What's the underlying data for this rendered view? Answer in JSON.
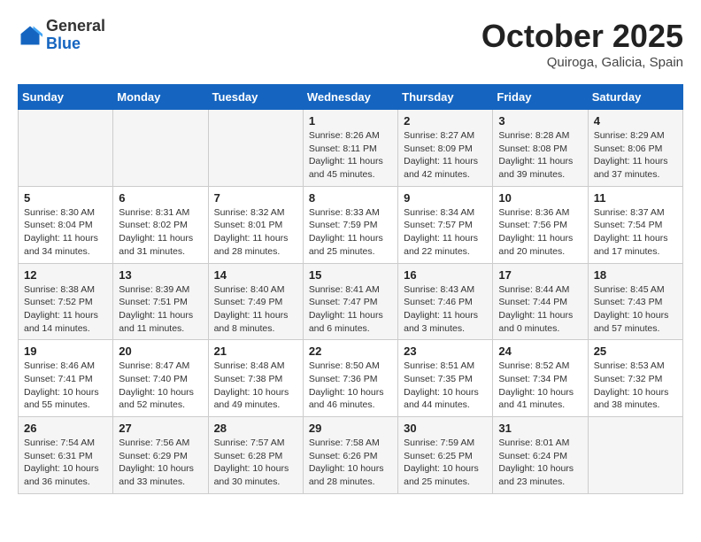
{
  "header": {
    "logo_general": "General",
    "logo_blue": "Blue",
    "month": "October 2025",
    "location": "Quiroga, Galicia, Spain"
  },
  "days_of_week": [
    "Sunday",
    "Monday",
    "Tuesday",
    "Wednesday",
    "Thursday",
    "Friday",
    "Saturday"
  ],
  "weeks": [
    [
      {
        "day": "",
        "info": ""
      },
      {
        "day": "",
        "info": ""
      },
      {
        "day": "",
        "info": ""
      },
      {
        "day": "1",
        "info": "Sunrise: 8:26 AM\nSunset: 8:11 PM\nDaylight: 11 hours and 45 minutes."
      },
      {
        "day": "2",
        "info": "Sunrise: 8:27 AM\nSunset: 8:09 PM\nDaylight: 11 hours and 42 minutes."
      },
      {
        "day": "3",
        "info": "Sunrise: 8:28 AM\nSunset: 8:08 PM\nDaylight: 11 hours and 39 minutes."
      },
      {
        "day": "4",
        "info": "Sunrise: 8:29 AM\nSunset: 8:06 PM\nDaylight: 11 hours and 37 minutes."
      }
    ],
    [
      {
        "day": "5",
        "info": "Sunrise: 8:30 AM\nSunset: 8:04 PM\nDaylight: 11 hours and 34 minutes."
      },
      {
        "day": "6",
        "info": "Sunrise: 8:31 AM\nSunset: 8:02 PM\nDaylight: 11 hours and 31 minutes."
      },
      {
        "day": "7",
        "info": "Sunrise: 8:32 AM\nSunset: 8:01 PM\nDaylight: 11 hours and 28 minutes."
      },
      {
        "day": "8",
        "info": "Sunrise: 8:33 AM\nSunset: 7:59 PM\nDaylight: 11 hours and 25 minutes."
      },
      {
        "day": "9",
        "info": "Sunrise: 8:34 AM\nSunset: 7:57 PM\nDaylight: 11 hours and 22 minutes."
      },
      {
        "day": "10",
        "info": "Sunrise: 8:36 AM\nSunset: 7:56 PM\nDaylight: 11 hours and 20 minutes."
      },
      {
        "day": "11",
        "info": "Sunrise: 8:37 AM\nSunset: 7:54 PM\nDaylight: 11 hours and 17 minutes."
      }
    ],
    [
      {
        "day": "12",
        "info": "Sunrise: 8:38 AM\nSunset: 7:52 PM\nDaylight: 11 hours and 14 minutes."
      },
      {
        "day": "13",
        "info": "Sunrise: 8:39 AM\nSunset: 7:51 PM\nDaylight: 11 hours and 11 minutes."
      },
      {
        "day": "14",
        "info": "Sunrise: 8:40 AM\nSunset: 7:49 PM\nDaylight: 11 hours and 8 minutes."
      },
      {
        "day": "15",
        "info": "Sunrise: 8:41 AM\nSunset: 7:47 PM\nDaylight: 11 hours and 6 minutes."
      },
      {
        "day": "16",
        "info": "Sunrise: 8:43 AM\nSunset: 7:46 PM\nDaylight: 11 hours and 3 minutes."
      },
      {
        "day": "17",
        "info": "Sunrise: 8:44 AM\nSunset: 7:44 PM\nDaylight: 11 hours and 0 minutes."
      },
      {
        "day": "18",
        "info": "Sunrise: 8:45 AM\nSunset: 7:43 PM\nDaylight: 10 hours and 57 minutes."
      }
    ],
    [
      {
        "day": "19",
        "info": "Sunrise: 8:46 AM\nSunset: 7:41 PM\nDaylight: 10 hours and 55 minutes."
      },
      {
        "day": "20",
        "info": "Sunrise: 8:47 AM\nSunset: 7:40 PM\nDaylight: 10 hours and 52 minutes."
      },
      {
        "day": "21",
        "info": "Sunrise: 8:48 AM\nSunset: 7:38 PM\nDaylight: 10 hours and 49 minutes."
      },
      {
        "day": "22",
        "info": "Sunrise: 8:50 AM\nSunset: 7:36 PM\nDaylight: 10 hours and 46 minutes."
      },
      {
        "day": "23",
        "info": "Sunrise: 8:51 AM\nSunset: 7:35 PM\nDaylight: 10 hours and 44 minutes."
      },
      {
        "day": "24",
        "info": "Sunrise: 8:52 AM\nSunset: 7:34 PM\nDaylight: 10 hours and 41 minutes."
      },
      {
        "day": "25",
        "info": "Sunrise: 8:53 AM\nSunset: 7:32 PM\nDaylight: 10 hours and 38 minutes."
      }
    ],
    [
      {
        "day": "26",
        "info": "Sunrise: 7:54 AM\nSunset: 6:31 PM\nDaylight: 10 hours and 36 minutes."
      },
      {
        "day": "27",
        "info": "Sunrise: 7:56 AM\nSunset: 6:29 PM\nDaylight: 10 hours and 33 minutes."
      },
      {
        "day": "28",
        "info": "Sunrise: 7:57 AM\nSunset: 6:28 PM\nDaylight: 10 hours and 30 minutes."
      },
      {
        "day": "29",
        "info": "Sunrise: 7:58 AM\nSunset: 6:26 PM\nDaylight: 10 hours and 28 minutes."
      },
      {
        "day": "30",
        "info": "Sunrise: 7:59 AM\nSunset: 6:25 PM\nDaylight: 10 hours and 25 minutes."
      },
      {
        "day": "31",
        "info": "Sunrise: 8:01 AM\nSunset: 6:24 PM\nDaylight: 10 hours and 23 minutes."
      },
      {
        "day": "",
        "info": ""
      }
    ]
  ]
}
